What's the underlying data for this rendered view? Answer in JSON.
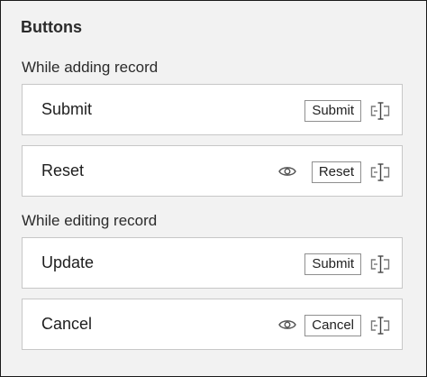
{
  "panel": {
    "title": "Buttons"
  },
  "sections": [
    {
      "title": "While adding record",
      "rows": [
        {
          "label": "Submit",
          "button_label": "Submit",
          "has_visibility_icon": false
        },
        {
          "label": "Reset",
          "button_label": "Reset",
          "has_visibility_icon": true
        }
      ]
    },
    {
      "title": "While editing record",
      "rows": [
        {
          "label": "Update",
          "button_label": "Submit",
          "has_visibility_icon": false
        },
        {
          "label": "Cancel",
          "button_label": "Cancel",
          "has_visibility_icon": true
        }
      ]
    }
  ],
  "icons": {
    "visibility": "eye-icon",
    "rename": "text-field-cursor-icon"
  },
  "colors": {
    "background": "#f2f2f2",
    "card": "#ffffff",
    "card_border": "#c7c7c7",
    "text": "#222222"
  }
}
